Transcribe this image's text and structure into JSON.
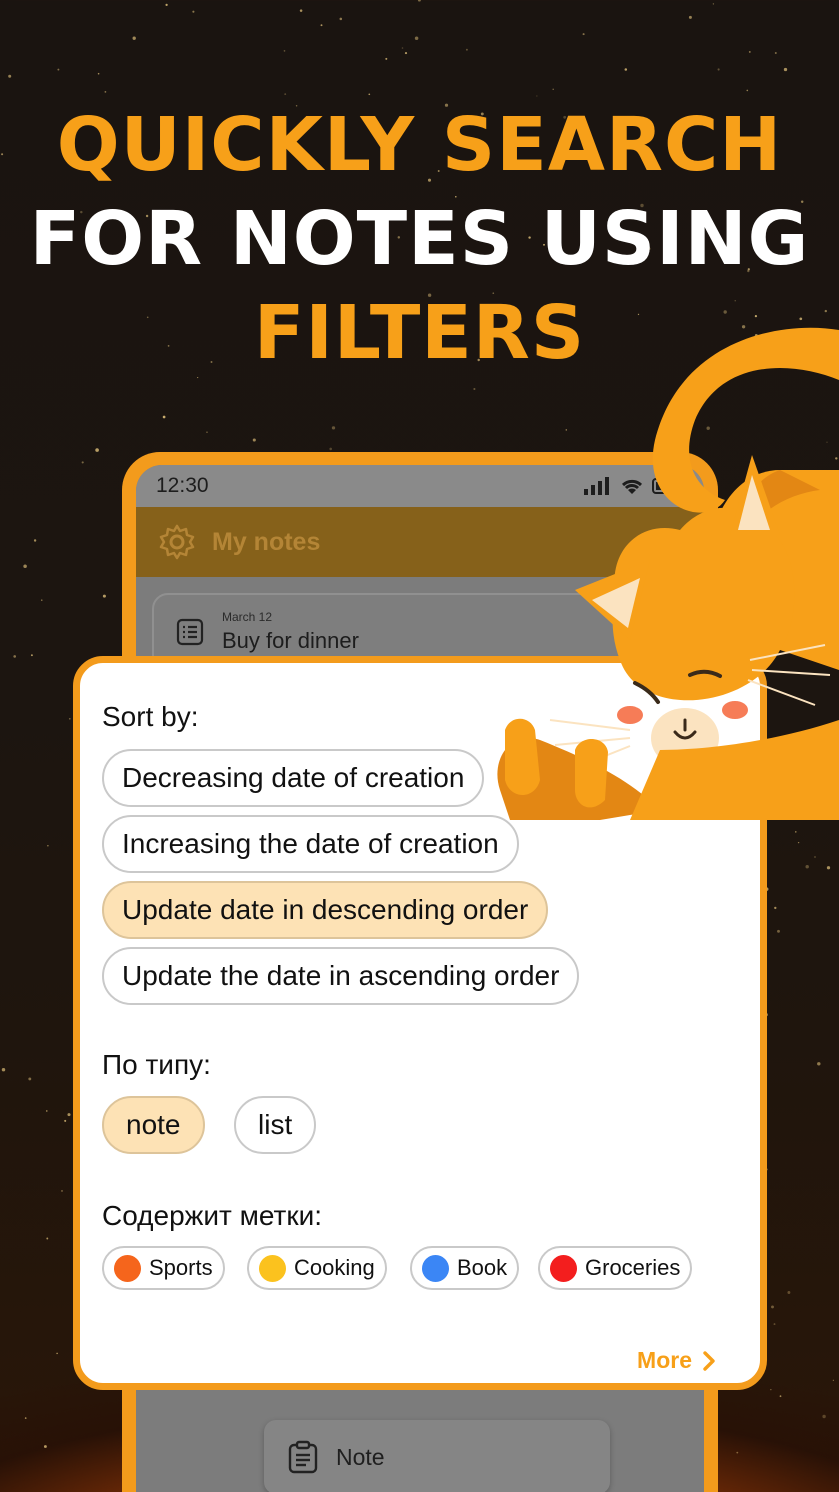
{
  "headline": {
    "line1": "QUICKLY SEARCH",
    "line2": "FOR NOTES USING",
    "line3": "FILTERS"
  },
  "colors": {
    "accent": "#f39b1c",
    "headline_orange": "#f7a019",
    "chip_selected": "#fde2b5"
  },
  "phone": {
    "status_time": "12:30",
    "status_icons": [
      "signal-icon",
      "wifi-icon",
      "battery-icon"
    ],
    "app_title": "My notes",
    "note_card": {
      "date": "March 12",
      "title": "Buy for dinner",
      "icon": "list-icon"
    },
    "bottom_item": {
      "label": "Note",
      "icon": "clipboard-icon"
    }
  },
  "filter_panel": {
    "sort_title": "Sort by:",
    "sort_options": [
      {
        "label": "Decreasing date of creation",
        "selected": false
      },
      {
        "label": "Increasing the date of creation",
        "selected": false
      },
      {
        "label": "Update date in descending order",
        "selected": true
      },
      {
        "label": "Update the date in ascending order",
        "selected": false
      }
    ],
    "type_title": "По типу:",
    "type_options": [
      {
        "label": "note",
        "selected": true
      },
      {
        "label": "list",
        "selected": false
      }
    ],
    "tags_title": "Содержит метки:",
    "tags": [
      {
        "label": "Sports",
        "color": "#f5651c"
      },
      {
        "label": "Cooking",
        "color": "#fbc21e"
      },
      {
        "label": "Book",
        "color": "#3b86f5"
      },
      {
        "label": "Groceries",
        "color": "#f31e1e"
      }
    ],
    "more_label": "More"
  }
}
